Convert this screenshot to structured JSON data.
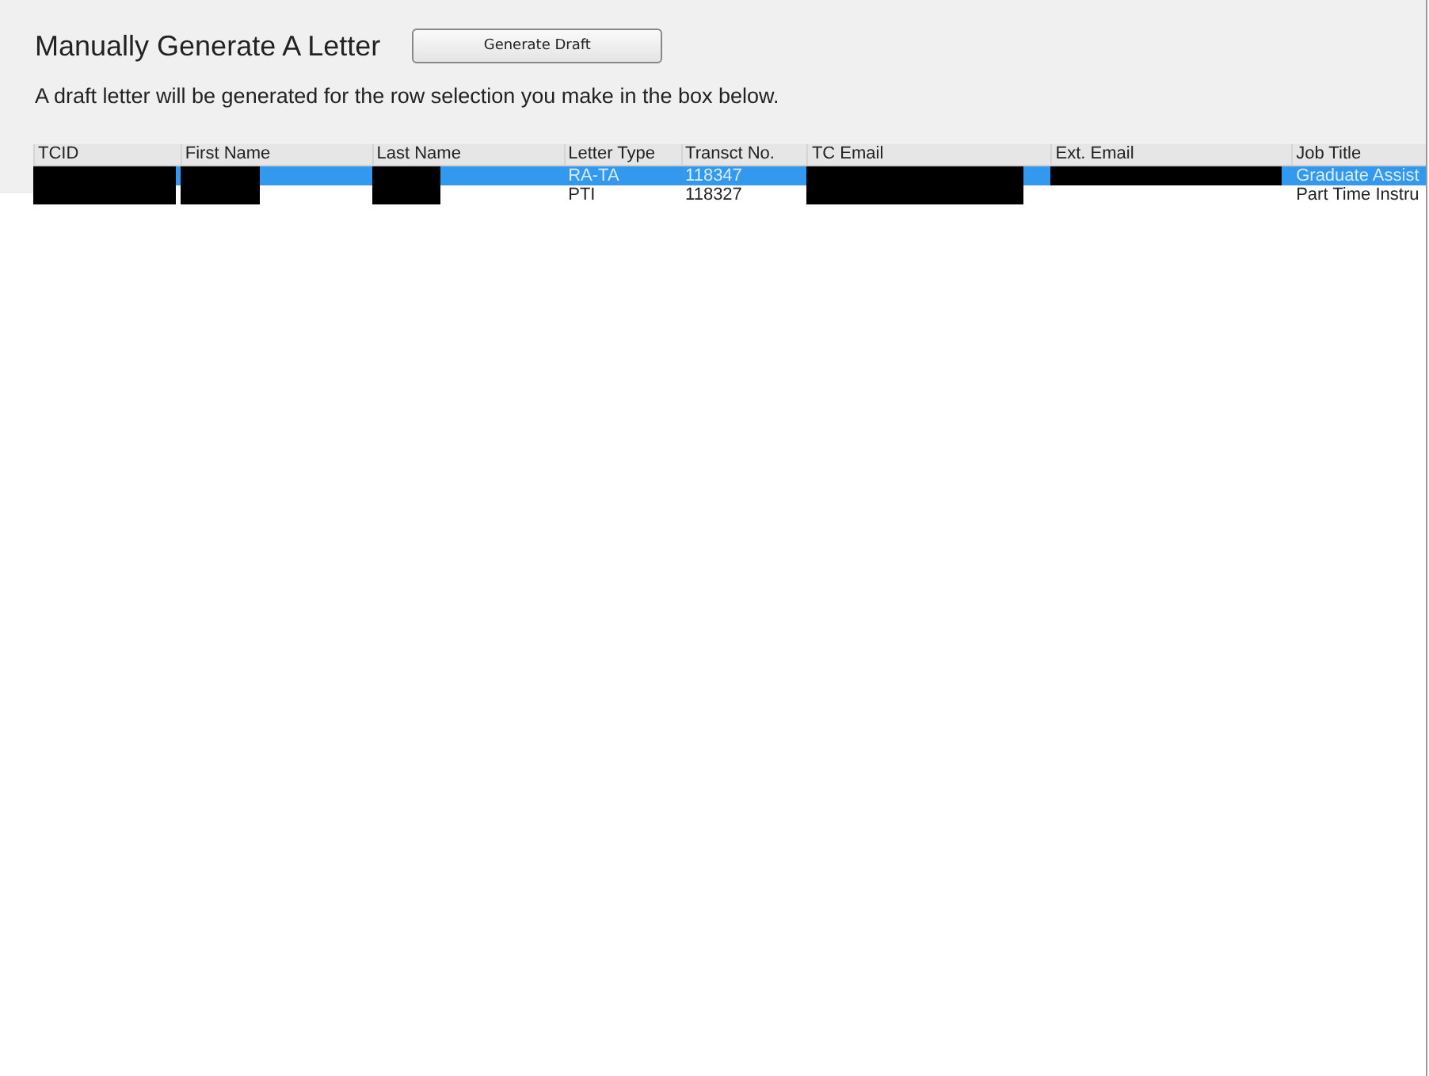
{
  "title": "Manually Generate A Letter",
  "generate_button": {
    "label": "Generate Draft"
  },
  "instructions": "A draft letter will be generated for the row selection you make in the box below.",
  "table": {
    "columns": [
      "TCID",
      "First Name",
      "Last Name",
      "Letter Type",
      "Transct No.",
      "TC Email",
      "Ext. Email",
      "Job Title"
    ],
    "rows": [
      {
        "selected": true,
        "cells": [
          {
            "redacted": true
          },
          {
            "redacted": true
          },
          {
            "redacted": true
          },
          {
            "text": "RA-TA"
          },
          {
            "text": "118347"
          },
          {
            "redacted": true
          },
          {
            "redacted": true
          },
          {
            "text": "Graduate Assist"
          }
        ]
      },
      {
        "selected": false,
        "cells": [
          {
            "redacted": true
          },
          {
            "redacted": true
          },
          {
            "redacted": true
          },
          {
            "text": "PTI"
          },
          {
            "text": "118327"
          },
          {
            "redacted": true
          },
          {
            "redacted": false
          },
          {
            "text": "Part Time Instru"
          }
        ]
      }
    ]
  }
}
